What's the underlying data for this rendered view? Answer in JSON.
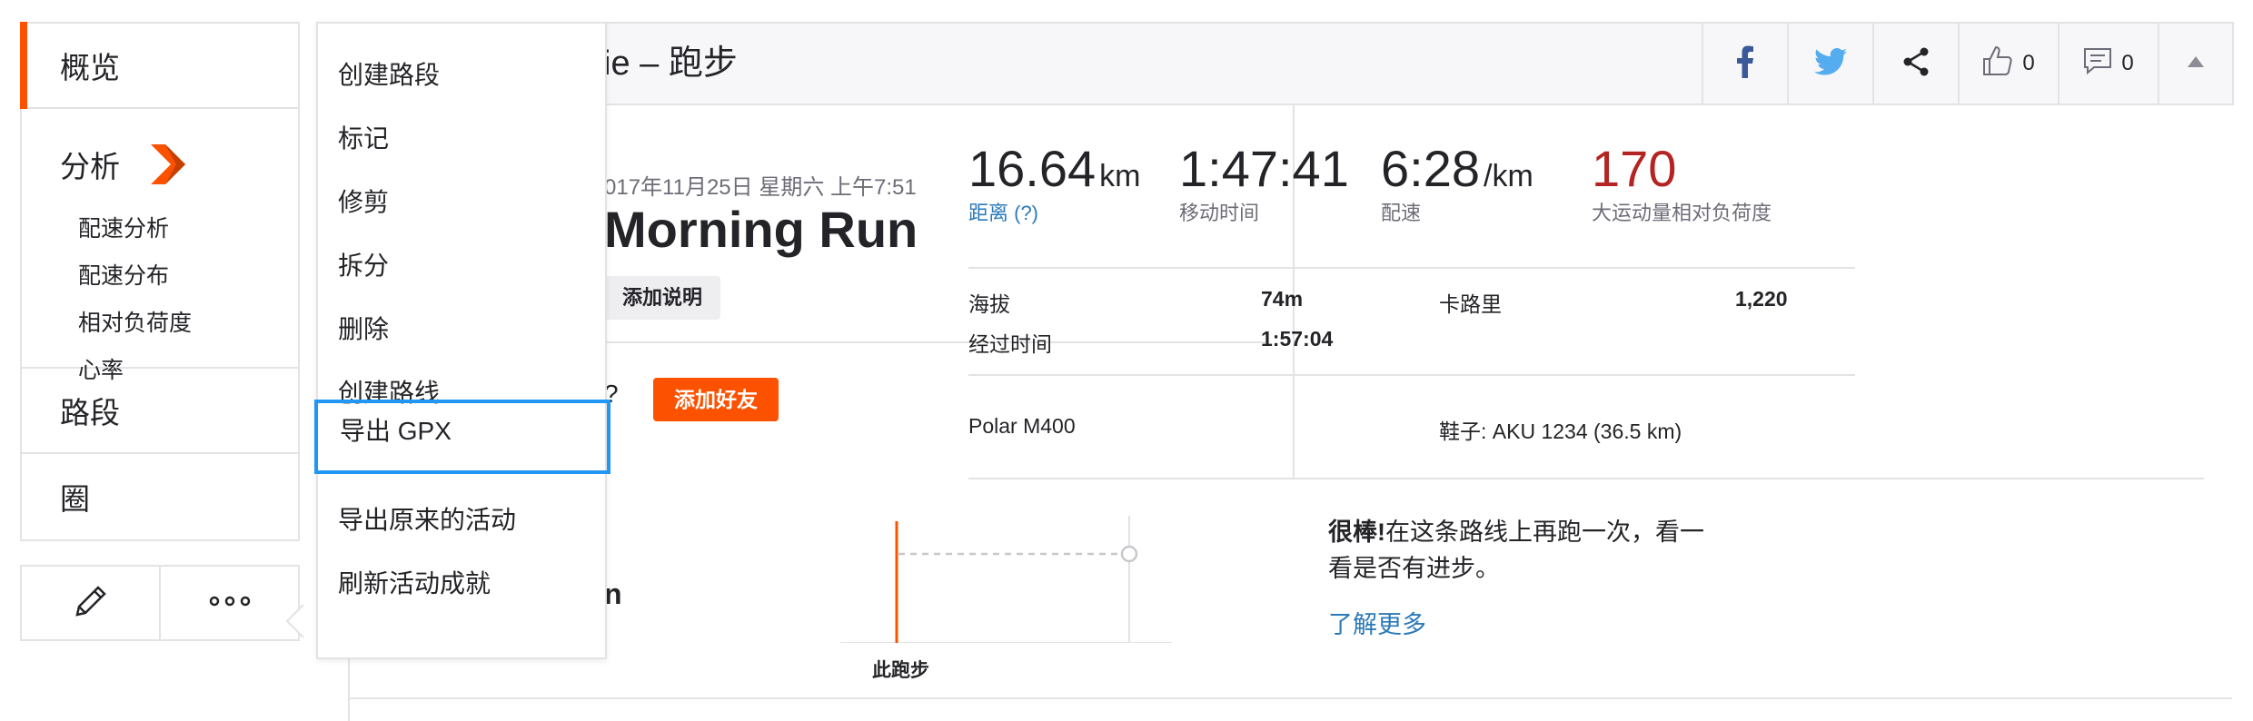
{
  "sidebar": {
    "overview": "概览",
    "analysis": "分析",
    "analysis_items": [
      "配速分析",
      "配速分布",
      "相对负荷度",
      "心率"
    ],
    "segments": "路段",
    "laps": "圈",
    "edit_icon": "pencil-icon",
    "more_icon": "more-dots-icon"
  },
  "dropdown": {
    "items": [
      "创建路段",
      "标记",
      "修剪",
      "拆分",
      "删除",
      "创建路线",
      "导出 GPX",
      "导出原来的活动",
      "刷新活动成就"
    ],
    "focused_index": 6
  },
  "header": {
    "title": "zie – 跑步",
    "kudos_count": "0",
    "comments_count": "0"
  },
  "activity": {
    "date": "017年11月25日 星期六 上午7:51",
    "name": "Morning Run",
    "add_description": "添加说明",
    "question_suffix": "?",
    "add_friend": "添加好友"
  },
  "stats": {
    "distance_value": "16.64",
    "distance_unit": "km",
    "distance_label": "距离 (?)",
    "moving_time_value": "1:47:41",
    "moving_time_label": "移动时间",
    "pace_value": "6:28",
    "pace_unit": "/km",
    "pace_label": "配速",
    "relative_effort_value": "170",
    "relative_effort_label": "大运动量相对负荷度",
    "elevation_label": "海拔",
    "elevation_value": "74m",
    "calories_label": "卡路里",
    "calories_value": "1,220",
    "elapsed_label": "经过时间",
    "elapsed_value": "1:57:04",
    "device": "Polar M400",
    "shoes": "鞋子: AKU 1234 (36.5 km)"
  },
  "segment": {
    "partial_text": "n",
    "chart_label": "此跑步",
    "promo_bold": "很棒!",
    "promo_text": "在这条路线上再跑一次，看一看是否有进步。",
    "learn_more": "了解更多"
  },
  "colors": {
    "brand_orange": "#fc5200",
    "focus_blue": "#2196f3",
    "link_blue": "#2b7ab8",
    "effort_red": "#b32522"
  }
}
